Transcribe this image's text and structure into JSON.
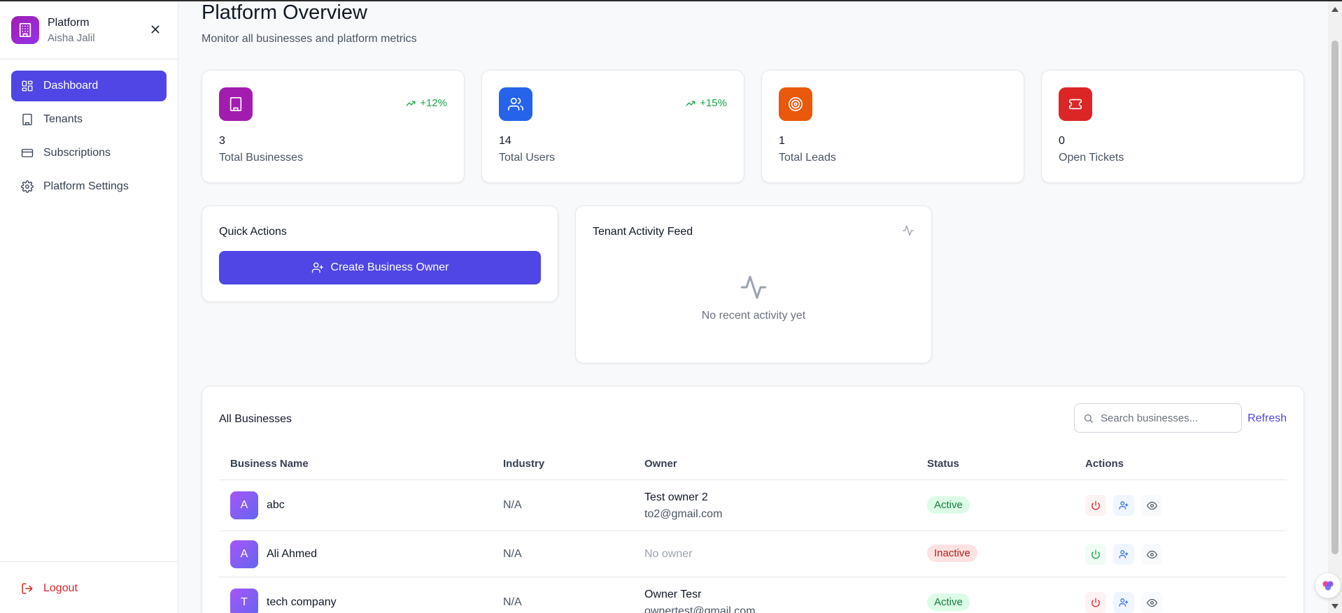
{
  "brand": {
    "title": "Platform",
    "user": "Aisha Jalil"
  },
  "sidebar": {
    "items": [
      {
        "label": "Dashboard",
        "icon": "grid-icon",
        "active": true
      },
      {
        "label": "Tenants",
        "icon": "building-icon"
      },
      {
        "label": "Subscriptions",
        "icon": "credit-card-icon"
      },
      {
        "label": "Platform Settings",
        "icon": "gear-icon"
      }
    ],
    "logout": "Logout"
  },
  "header": {
    "title": "Platform Overview",
    "subtitle": "Monitor all businesses and platform metrics"
  },
  "stats": [
    {
      "value": "3",
      "label": "Total Businesses",
      "trend": "+12%",
      "color": "#a21caf"
    },
    {
      "value": "14",
      "label": "Total Users",
      "trend": "+15%",
      "color": "#2563eb"
    },
    {
      "value": "1",
      "label": "Total Leads",
      "trend": "",
      "color": "#ea580c"
    },
    {
      "value": "0",
      "label": "Open Tickets",
      "trend": "",
      "color": "#dc2626"
    }
  ],
  "quick_actions": {
    "title": "Quick Actions",
    "button": "Create Business Owner"
  },
  "activity": {
    "title": "Tenant Activity Feed",
    "empty": "No recent activity yet"
  },
  "businesses": {
    "title": "All Businesses",
    "search_placeholder": "Search businesses...",
    "refresh": "Refresh",
    "columns": [
      "Business Name",
      "Industry",
      "Owner",
      "Status",
      "Actions"
    ],
    "rows": [
      {
        "initial": "A",
        "name": "abc",
        "industry": "N/A",
        "owner": "Test owner 2",
        "email": "to2@gmail.com",
        "status": "Active"
      },
      {
        "initial": "A",
        "name": "Ali Ahmed",
        "industry": "N/A",
        "owner": "No owner",
        "email": "",
        "status": "Inactive"
      },
      {
        "initial": "T",
        "name": "tech company",
        "industry": "N/A",
        "owner": "Owner Tesr",
        "email": "ownertest@gmail.com",
        "status": "Active"
      }
    ]
  },
  "colors": {
    "accent": "#4f46e5",
    "danger": "#dc2626",
    "success": "#16a34a"
  }
}
